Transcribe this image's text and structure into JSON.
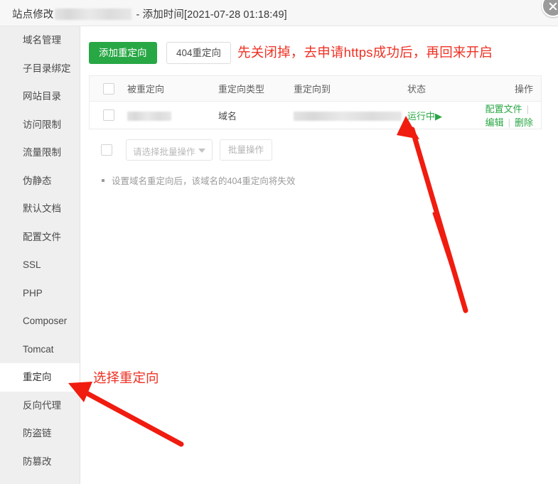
{
  "window": {
    "title_prefix": "站点修改",
    "title_suffix": " - 添加时间[2021-07-28 01:18:49]",
    "close_icon": "close-circle-icon"
  },
  "sidebar": {
    "items": [
      {
        "label": "域名管理",
        "active": false
      },
      {
        "label": "子目录绑定",
        "active": false
      },
      {
        "label": "网站目录",
        "active": false
      },
      {
        "label": "访问限制",
        "active": false
      },
      {
        "label": "流量限制",
        "active": false
      },
      {
        "label": "伪静态",
        "active": false
      },
      {
        "label": "默认文档",
        "active": false
      },
      {
        "label": "配置文件",
        "active": false
      },
      {
        "label": "SSL",
        "active": false
      },
      {
        "label": "PHP",
        "active": false
      },
      {
        "label": "Composer",
        "active": false
      },
      {
        "label": "Tomcat",
        "active": false
      },
      {
        "label": "重定向",
        "active": true
      },
      {
        "label": "反向代理",
        "active": false
      },
      {
        "label": "防盗链",
        "active": false
      },
      {
        "label": "防篡改",
        "active": false
      }
    ]
  },
  "toolbar": {
    "add_redirect_label": "添加重定向",
    "redirect_404_label": "404重定向"
  },
  "table": {
    "headers": [
      "被重定向",
      "重定向类型",
      "重定向到",
      "状态",
      "操作"
    ],
    "rows": [
      {
        "from": "",
        "type": "域名",
        "to": "",
        "status": "运行中",
        "status_icon": "play-triangle-icon",
        "status_color": "#2aa745",
        "ops": [
          "配置文件",
          "编辑",
          "删除"
        ]
      }
    ]
  },
  "batch": {
    "select_placeholder": "请选择批量操作",
    "select_caret_icon": "chevron-down-icon",
    "button_label": "批量操作"
  },
  "note": {
    "text": "设置域名重定向后，该域名的404重定向将失效"
  },
  "annotations": {
    "top": "先关闭掉，去申请https成功后，再回来开启",
    "bottom": "选择重定向",
    "color": "#ee3224"
  },
  "colors": {
    "primary_green": "#28a745",
    "link_green": "#2aa745",
    "annotation_red": "#ee3224",
    "sidebar_bg": "#efefef",
    "titlebar_bg": "#f7f7f7"
  }
}
